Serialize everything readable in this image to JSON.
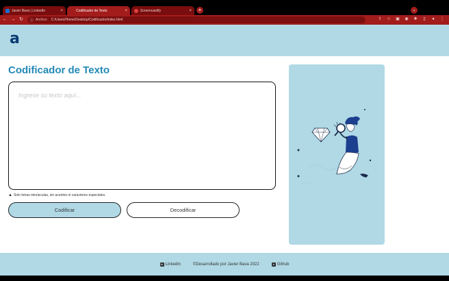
{
  "browser": {
    "tabs": [
      {
        "label": "Javier Bava | LinkedIn",
        "icon": "linkedin-icon"
      },
      {
        "label": "Codificador de Texto",
        "icon": "page-icon"
      },
      {
        "label": "Screencastify",
        "icon": "screencastify-icon"
      }
    ],
    "new_tab": "+",
    "tab_menu": "⌄",
    "nav": {
      "back": "←",
      "forward": "→",
      "reload": "↻"
    },
    "address": {
      "scheme": "Archivo",
      "url": "C:/Users/Home/Desktop/Codificador/index.html"
    },
    "accent": "#a31c1c"
  },
  "site": {
    "logo": "a",
    "title": "Codificador de Texto",
    "textarea_placeholder": "Ingrese su texto aquí...",
    "warning": "Solo letras minúsculas, sin acentos ni caracteres especiales.",
    "encode_label": "Codificar",
    "decode_label": "Decodificar",
    "footer": {
      "linkedin": "Linkedin",
      "credit": "©Desarrollado por Javier Bava 2022",
      "github": "Github"
    },
    "colors": {
      "header_bg": "#b0d9e5",
      "title": "#2289b5",
      "logo": "#0a3a73"
    }
  }
}
